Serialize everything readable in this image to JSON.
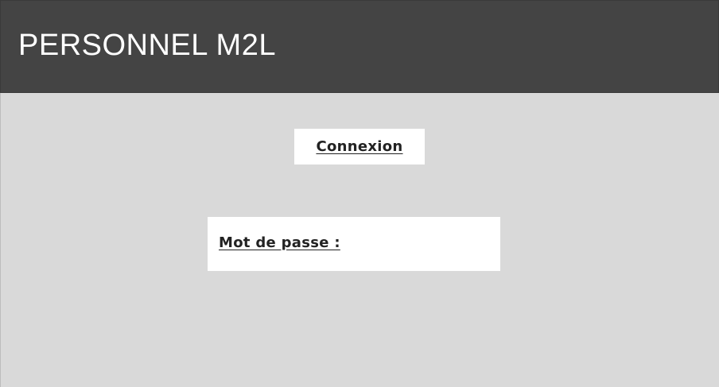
{
  "header": {
    "title": "PERSONNEL M2L"
  },
  "login": {
    "button_label": "Connexion"
  },
  "password": {
    "label": "Mot de passe :",
    "value": ""
  },
  "colors": {
    "header_bg": "#444444",
    "page_bg": "#d9d9d9",
    "panel_bg": "#ffffff",
    "text_dark": "#222222",
    "text_light": "#ffffff"
  }
}
